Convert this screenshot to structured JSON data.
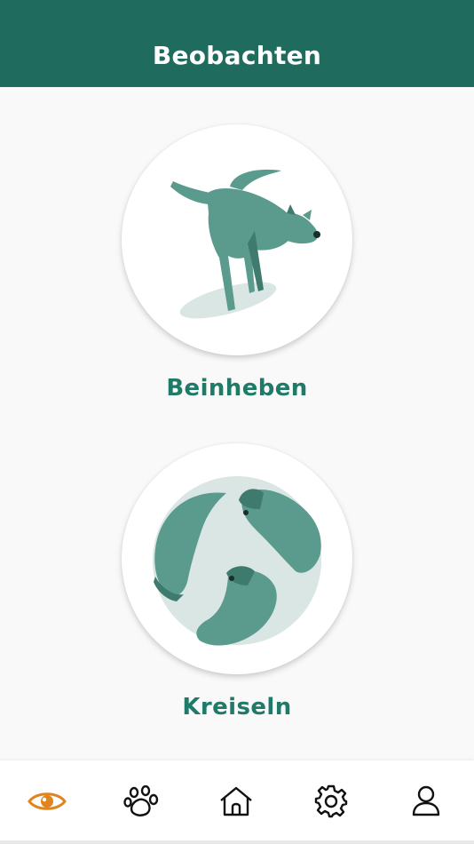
{
  "header": {
    "title": "Beobachten"
  },
  "cards": [
    {
      "label": "Beinheben"
    },
    {
      "label": "Kreiseln"
    }
  ],
  "tabbar": {
    "tabs": [
      {
        "icon": "eye-icon",
        "active": true
      },
      {
        "icon": "paw-icon",
        "active": false
      },
      {
        "icon": "home-icon",
        "active": false
      },
      {
        "icon": "gear-icon",
        "active": false
      },
      {
        "icon": "user-icon",
        "active": false
      }
    ]
  },
  "colors": {
    "header": "#1f6b5e",
    "label": "#1f7a68",
    "dog": "#5a9b8d",
    "dog_dark": "#3e7a6d",
    "shadow": "#d9e6e4",
    "active_tab": "#e0851e",
    "inactive_tab": "#111111"
  }
}
